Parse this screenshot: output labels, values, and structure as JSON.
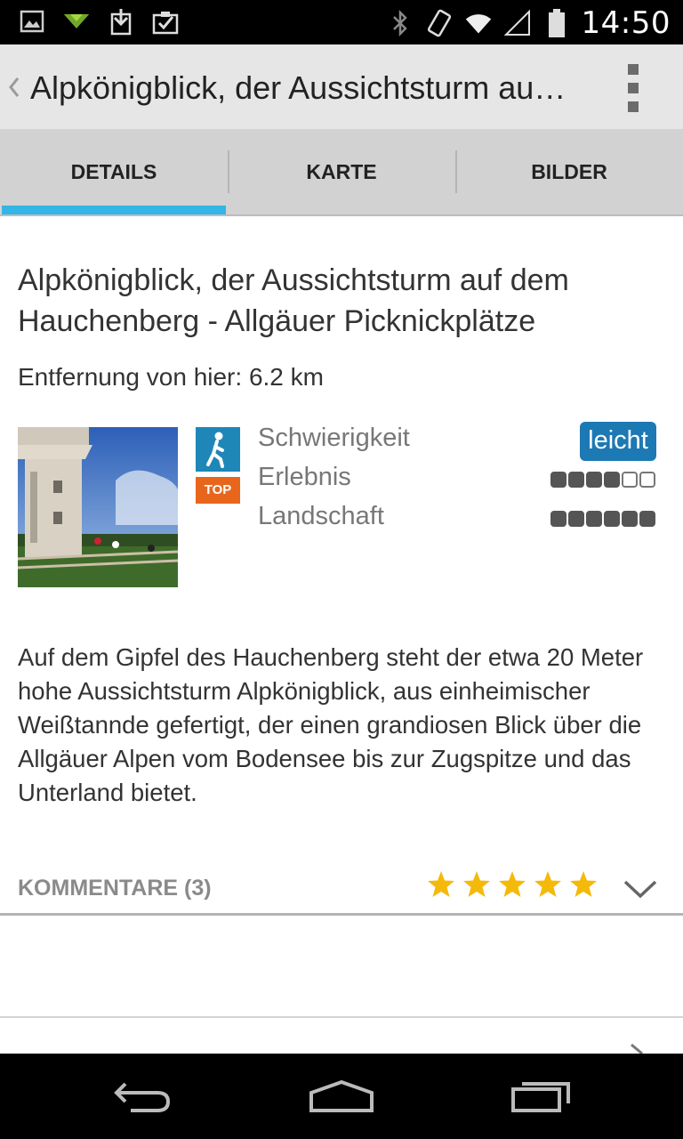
{
  "status_bar": {
    "time": "14:50",
    "left_icons": [
      "image-icon",
      "arrow-icon",
      "download-icon",
      "clipboard-check-icon"
    ],
    "right_icons": [
      "bluetooth-icon",
      "vibrate-icon",
      "wifi-icon",
      "signal-icon",
      "battery-icon"
    ]
  },
  "action_bar": {
    "title": "Alpkönigblick, der Aussichtsturm auf dem Hauchenberg - Allgäuer Picknickplätze"
  },
  "tabs": [
    {
      "label": "DETAILS",
      "active": true
    },
    {
      "label": "KARTE",
      "active": false
    },
    {
      "label": "BILDER",
      "active": false
    }
  ],
  "detail": {
    "title": "Alpkönigblick, der Aussichtsturm auf dem Hauchenberg - Allgäuer Picknickplätze",
    "distance": "Entfernung von hier: 6.2 km",
    "top_badge": "TOP",
    "ratings": {
      "difficulty_label": "Schwierigkeit",
      "difficulty_value": "leicht",
      "experience_label": "Erlebnis",
      "experience_value": 4,
      "experience_max": 6,
      "landscape_label": "Landschaft",
      "landscape_value": 6,
      "landscape_max": 6
    },
    "description": "Auf dem Gipfel des Hauchenberg steht der etwa 20 Meter hohe Aussichtsturm Alpkönigblick, aus einheimischer Weißtannde gefertigt, der einen grandiosen Blick über die Allgäuer Alpen vom Bodensee bis zur Zugspitze und das Unterland bietet.",
    "comments_label": "KOMMENTARE (3)",
    "comments_rating": 5,
    "comments_rating_max": 5
  },
  "colors": {
    "accent_tab": "#33b5e5",
    "difficulty_badge": "#1d79b3",
    "top_badge": "#e8661c",
    "star": "#f5b90a"
  }
}
